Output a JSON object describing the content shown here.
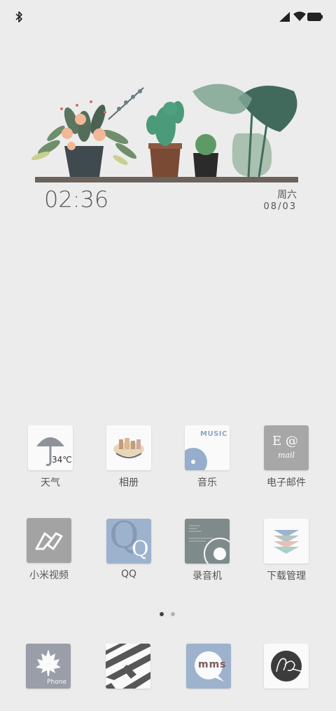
{
  "status_bar": {
    "left_icons": [
      "bluetooth-icon"
    ],
    "right_icons": [
      "cellular-signal-icon",
      "wifi-icon",
      "battery-icon"
    ]
  },
  "clock_widget": {
    "time": "02:36",
    "weekday": "周六",
    "date": "08/03"
  },
  "home_grid": [
    {
      "label": "天气",
      "icon": "weather-umbrella-icon",
      "badge": "34℃"
    },
    {
      "label": "相册",
      "icon": "gallery-icon"
    },
    {
      "label": "音乐",
      "icon": "music-icon",
      "badge": "MUSIC"
    },
    {
      "label": "电子邮件",
      "icon": "email-icon",
      "badge_top": "E @",
      "badge_bottom": "mail"
    },
    {
      "label": "小米视频",
      "icon": "video-icon"
    },
    {
      "label": "QQ",
      "icon": "qq-icon",
      "badge": "Q"
    },
    {
      "label": "录音机",
      "icon": "recorder-icon"
    },
    {
      "label": "下载管理",
      "icon": "downloads-icon"
    }
  ],
  "page_indicator": {
    "pages": 2,
    "current": 1
  },
  "dock": [
    {
      "icon": "phone-icon",
      "badge": "Phone"
    },
    {
      "icon": "stripes-app-icon"
    },
    {
      "icon": "messages-icon",
      "badge": "mms"
    },
    {
      "icon": "browser-icon"
    }
  ],
  "colors": {
    "background": "#ececec",
    "icon_gray": "#a3a3a3",
    "icon_blue": "#96aecb",
    "icon_slate": "#7f8b8b"
  }
}
